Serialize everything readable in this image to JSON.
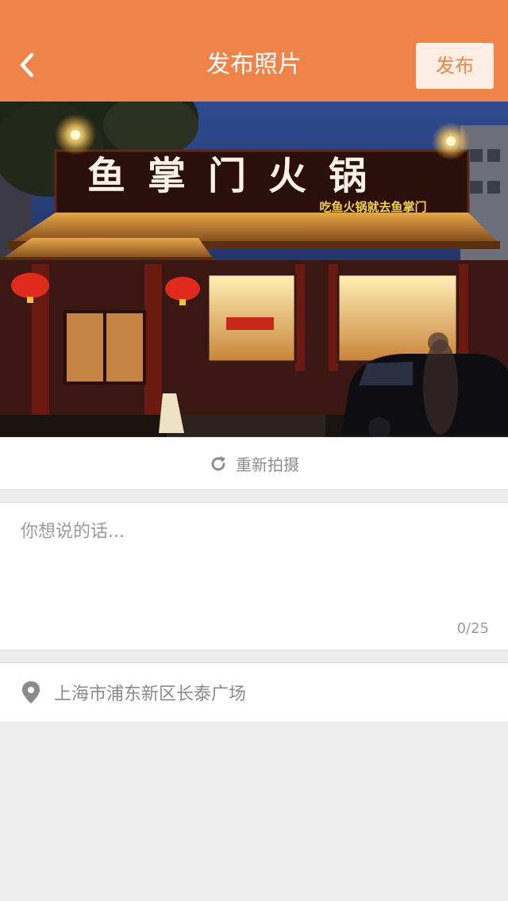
{
  "header": {
    "title": "发布照片",
    "publish_label": "发布",
    "background": "#f0834a",
    "back_icon": "chevron-left-icon"
  },
  "photo": {
    "sign_text": "鱼掌门火锅",
    "slogan_text": "吃鱼火锅就去鱼掌门"
  },
  "retake": {
    "label": "重新拍摄",
    "icon": "refresh-icon"
  },
  "comment": {
    "placeholder": "你想说的话...",
    "value": "",
    "count": "0/25"
  },
  "location": {
    "icon": "location-pin-icon",
    "text": "上海市浦东新区长泰广场"
  }
}
